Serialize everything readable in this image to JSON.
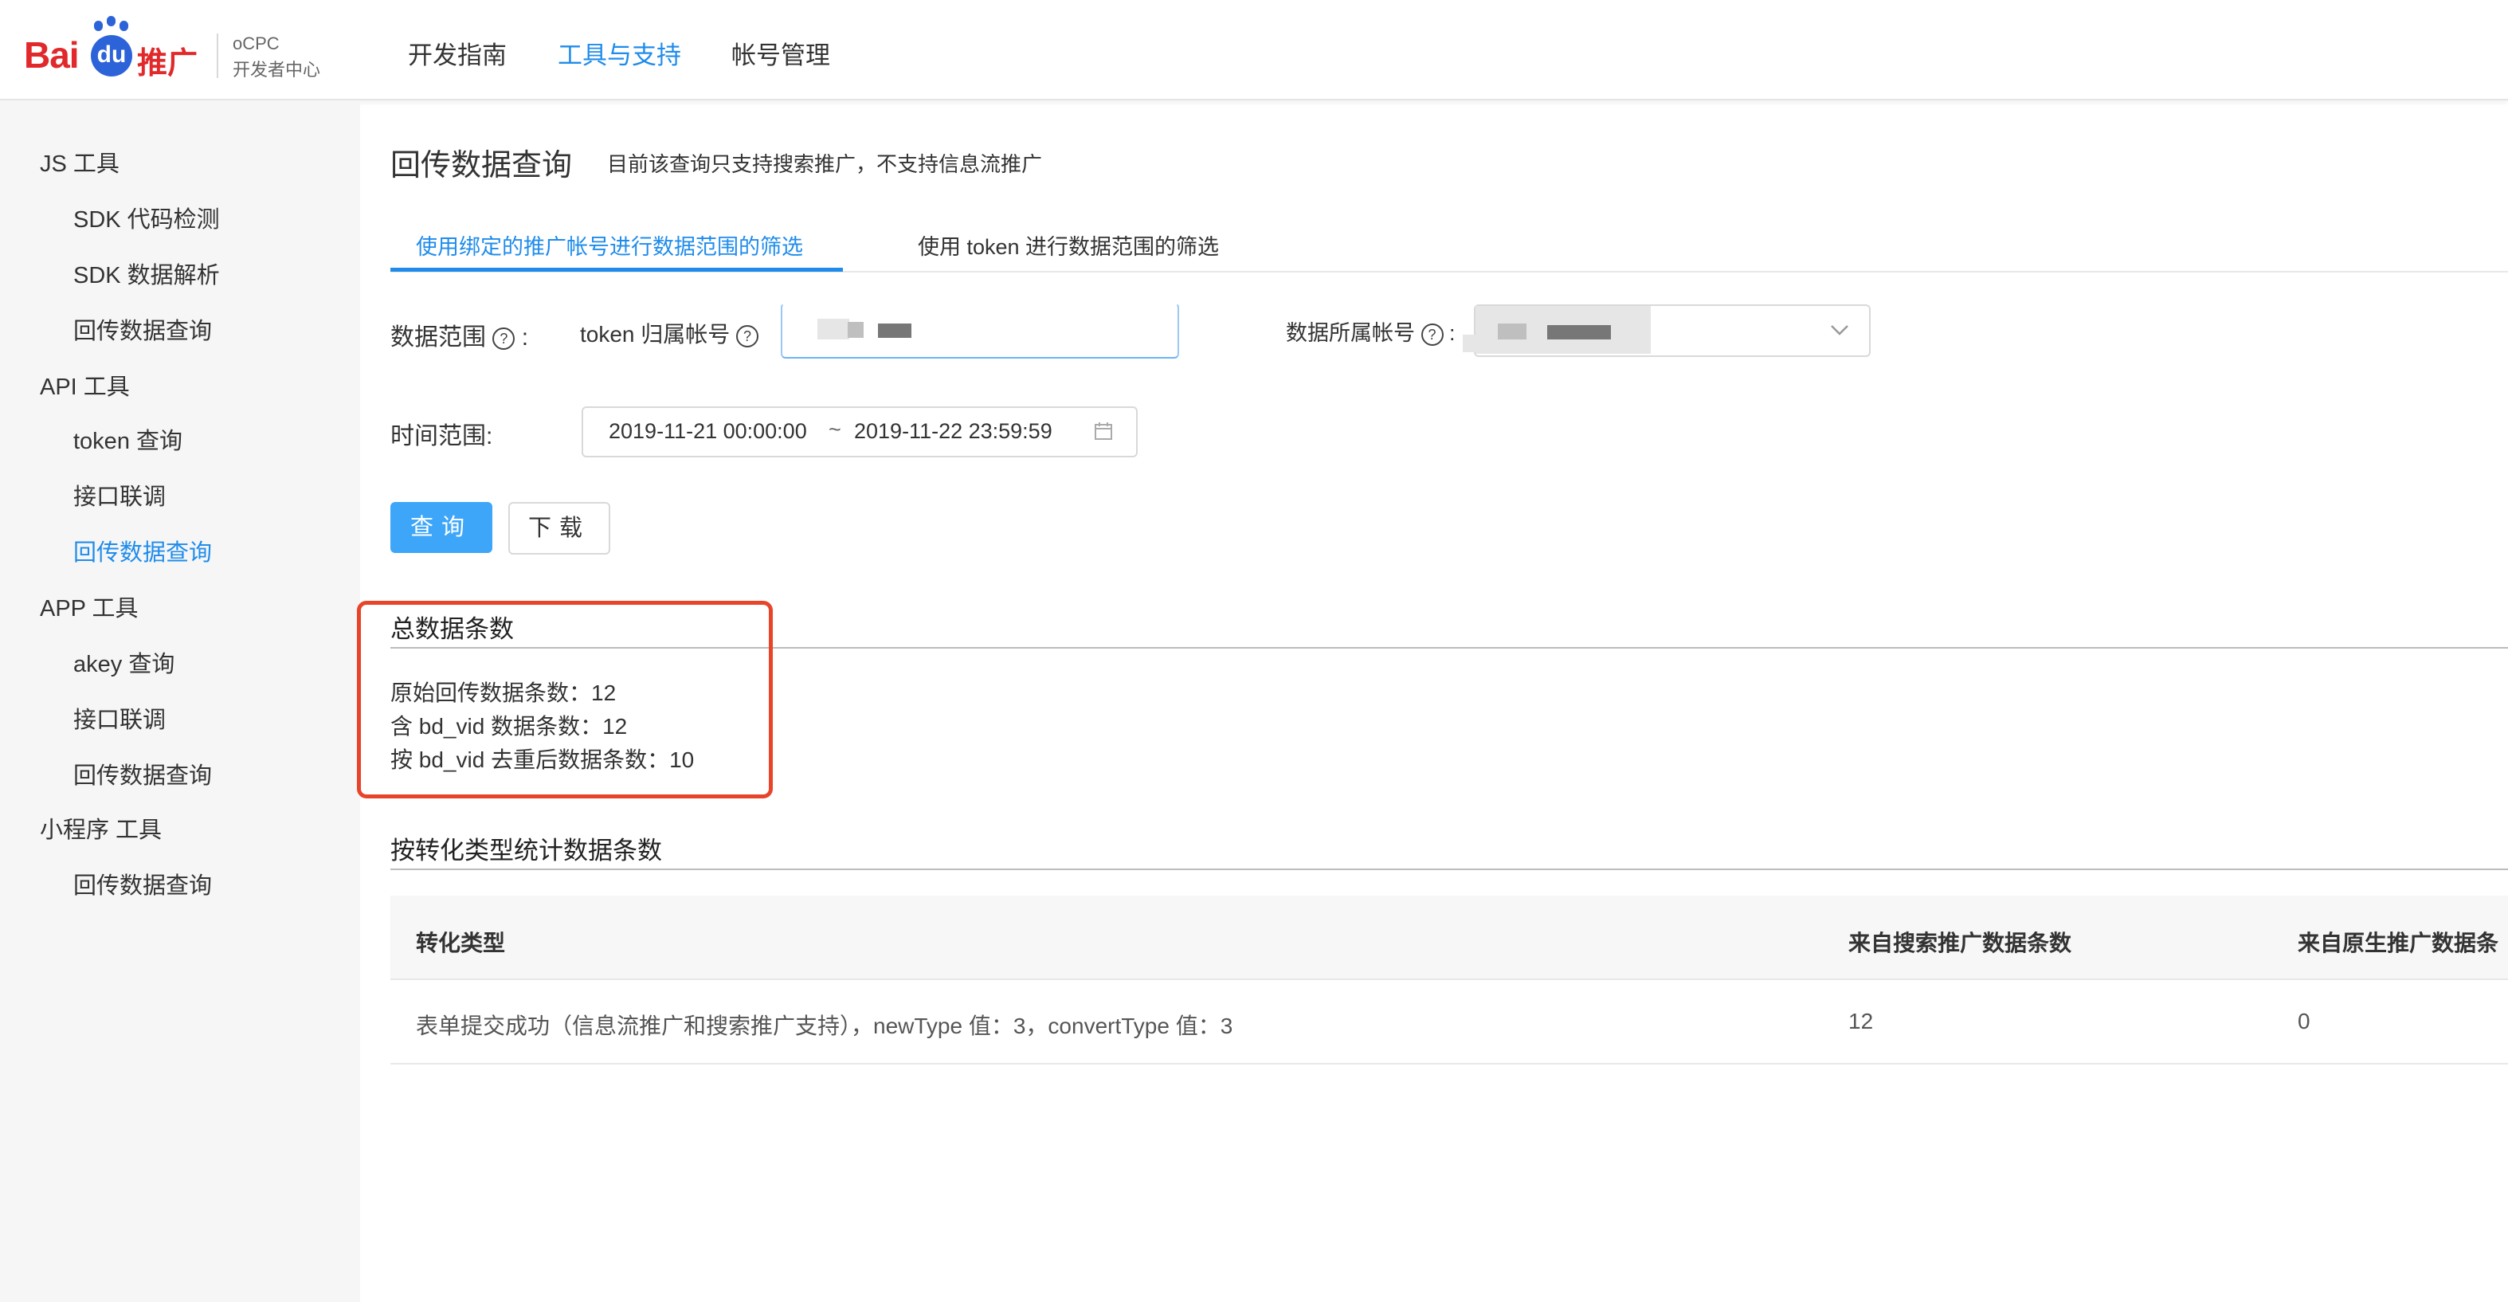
{
  "header": {
    "logo": {
      "text_bai": "Bai",
      "text_du": "du",
      "text_suffix": "推广",
      "product": "oCPC",
      "subtitle": "开发者中心"
    },
    "nav": [
      {
        "label": "开发指南",
        "active": false
      },
      {
        "label": "工具与支持",
        "active": true
      },
      {
        "label": "帐号管理",
        "active": false
      }
    ]
  },
  "sidebar": {
    "groups": [
      {
        "label": "JS 工具",
        "items": [
          "SDK 代码检测",
          "SDK 数据解析",
          "回传数据查询"
        ]
      },
      {
        "label": "API 工具",
        "items": [
          "token 查询",
          "接口联调",
          "回传数据查询"
        ]
      },
      {
        "label": "APP 工具",
        "items": [
          "akey 查询",
          "接口联调",
          "回传数据查询"
        ]
      },
      {
        "label": "小程序 工具",
        "items": [
          "回传数据查询"
        ]
      }
    ],
    "active_item": "API 工具 / 回传数据查询"
  },
  "main": {
    "title": "回传数据查询",
    "subtitle": "目前该查询只支持搜索推广，不支持信息流推广",
    "tabs": [
      {
        "label": "使用绑定的推广帐号进行数据范围的筛选",
        "active": true
      },
      {
        "label": "使用 token 进行数据范围的筛选",
        "active": false
      }
    ],
    "filters": {
      "data_range_label": "数据范围",
      "data_range_colon": ":",
      "token_owner_label": "token 归属帐号",
      "account_label": "数据所属帐号",
      "account_colon": ":",
      "time_range_label": "时间范围:",
      "date_start": "2019-11-21 00:00:00",
      "date_separator": "~",
      "date_end": "2019-11-22 23:59:59"
    },
    "buttons": {
      "query": "查询",
      "download": "下载"
    },
    "summary": {
      "title": "总数据条数",
      "lines": [
        "原始回传数据条数：12",
        "含 bd_vid 数据条数：12",
        "按 bd_vid 去重后数据条数：10"
      ]
    },
    "by_type": {
      "title": "按转化类型统计数据条数",
      "columns": [
        "转化类型",
        "来自搜索推广数据条数",
        "来自原生推广数据条"
      ],
      "rows": [
        [
          "表单提交成功（信息流推广和搜索推广支持），newType 值：3，convertType 值：3",
          "12",
          "0"
        ]
      ]
    }
  },
  "colors": {
    "accent": "#1f8ceb",
    "primary_button": "#3ea6f8",
    "highlight": "#e8442a",
    "brand_red": "#e1292b",
    "brand_blue": "#2d63d8"
  }
}
